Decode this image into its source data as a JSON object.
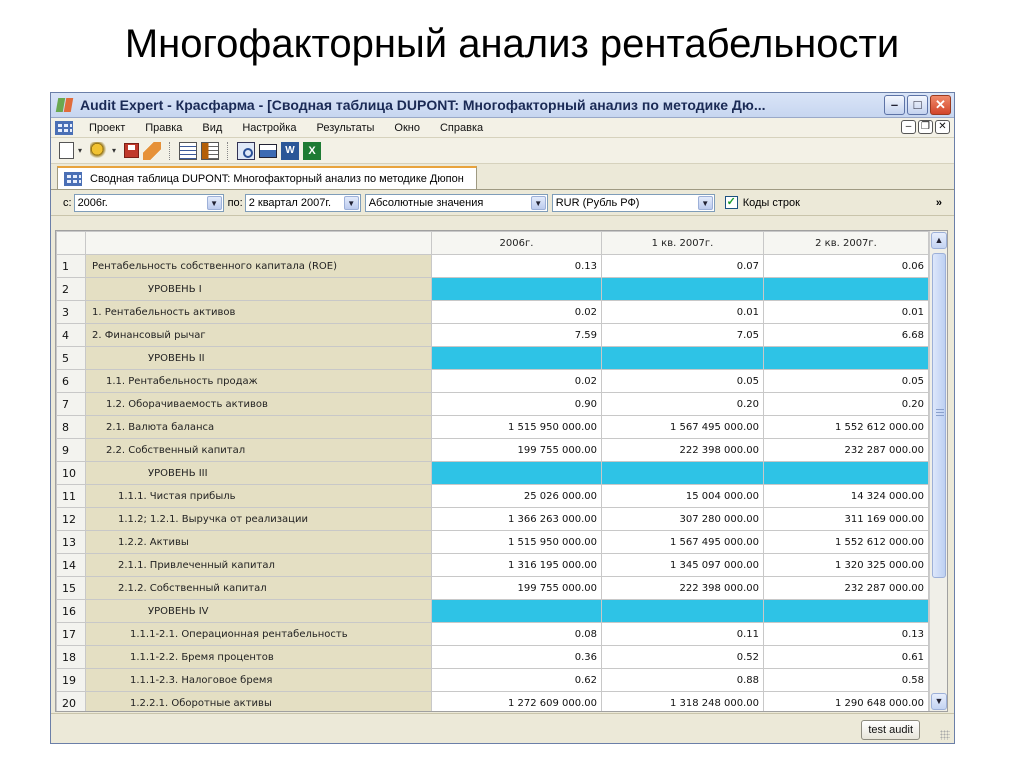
{
  "slide": {
    "title": "Многофакторный анализ рентабельности"
  },
  "window": {
    "title": "Audit Expert - Красфарма  - [Сводная таблица DUPONT: Многофакторный анализ по методике Дю...",
    "minimize": "–",
    "maximize": "□",
    "close": "✕"
  },
  "menu": {
    "items": [
      "Проект",
      "Правка",
      "Вид",
      "Настройка",
      "Результаты",
      "Окно",
      "Справка"
    ],
    "mdi_minimize": "–",
    "mdi_restore": "❐",
    "mdi_close": "✕"
  },
  "toolbar": {
    "icons": [
      "new-document-icon",
      "tools-icon",
      "save-icon",
      "erase-icon",
      "table-view-icon",
      "report-view-icon",
      "print-preview-icon",
      "print-icon",
      "word-export-icon",
      "excel-export-icon"
    ]
  },
  "tab": {
    "label": "Сводная таблица DUPONT: Многофакторный анализ по методике Дюпон"
  },
  "filters": {
    "from_label": "с:",
    "from_value": "2006г.",
    "to_label": "по:",
    "to_value": "2 квартал 2007г.",
    "mode_value": "Абсолютные значения",
    "currency_value": "RUR (Рубль РФ)",
    "codes_checked": "✓",
    "codes_label": "Коды строк",
    "more": "»"
  },
  "grid": {
    "columns": [
      "2006г.",
      "1 кв. 2007г.",
      "2 кв. 2007г."
    ],
    "rows": [
      {
        "n": "1",
        "label": "Рентабельность собственного капитала (ROE)",
        "level": false,
        "indent": 0,
        "v": [
          "0.13",
          "0.07",
          "0.06"
        ]
      },
      {
        "n": "2",
        "label": "УРОВЕНЬ I",
        "level": true,
        "indent": 0,
        "v": [
          "",
          "",
          ""
        ]
      },
      {
        "n": "3",
        "label": "1. Рентабельность активов",
        "level": false,
        "indent": 0,
        "v": [
          "0.02",
          "0.01",
          "0.01"
        ]
      },
      {
        "n": "4",
        "label": "2. Финансовый рычаг",
        "level": false,
        "indent": 0,
        "v": [
          "7.59",
          "7.05",
          "6.68"
        ]
      },
      {
        "n": "5",
        "label": "УРОВЕНЬ II",
        "level": true,
        "indent": 0,
        "v": [
          "",
          "",
          ""
        ]
      },
      {
        "n": "6",
        "label": "1.1. Рентабельность продаж",
        "level": false,
        "indent": 1,
        "v": [
          "0.02",
          "0.05",
          "0.05"
        ]
      },
      {
        "n": "7",
        "label": "1.2. Оборачиваемость активов",
        "level": false,
        "indent": 1,
        "v": [
          "0.90",
          "0.20",
          "0.20"
        ]
      },
      {
        "n": "8",
        "label": "2.1. Валюта баланса",
        "level": false,
        "indent": 1,
        "v": [
          "1 515 950 000.00",
          "1 567 495 000.00",
          "1 552 612 000.00"
        ]
      },
      {
        "n": "9",
        "label": "2.2. Собственный капитал",
        "level": false,
        "indent": 1,
        "v": [
          "199 755 000.00",
          "222 398 000.00",
          "232 287 000.00"
        ]
      },
      {
        "n": "10",
        "label": "УРОВЕНЬ III",
        "level": true,
        "indent": 0,
        "v": [
          "",
          "",
          ""
        ]
      },
      {
        "n": "11",
        "label": "1.1.1. Чистая прибыль",
        "level": false,
        "indent": 2,
        "v": [
          "25 026 000.00",
          "15 004 000.00",
          "14 324 000.00"
        ]
      },
      {
        "n": "12",
        "label": "1.1.2; 1.2.1. Выручка от реализации",
        "level": false,
        "indent": 2,
        "v": [
          "1 366 263 000.00",
          "307 280 000.00",
          "311 169 000.00"
        ]
      },
      {
        "n": "13",
        "label": "1.2.2. Активы",
        "level": false,
        "indent": 2,
        "v": [
          "1 515 950 000.00",
          "1 567 495 000.00",
          "1 552 612 000.00"
        ]
      },
      {
        "n": "14",
        "label": "2.1.1. Привлеченный капитал",
        "level": false,
        "indent": 2,
        "v": [
          "1 316 195 000.00",
          "1 345 097 000.00",
          "1 320 325 000.00"
        ]
      },
      {
        "n": "15",
        "label": "2.1.2. Собственный капитал",
        "level": false,
        "indent": 2,
        "v": [
          "199 755 000.00",
          "222 398 000.00",
          "232 287 000.00"
        ]
      },
      {
        "n": "16",
        "label": "УРОВЕНЬ IV",
        "level": true,
        "indent": 0,
        "v": [
          "",
          "",
          ""
        ]
      },
      {
        "n": "17",
        "label": "1.1.1-2.1. Операционная рентабельность",
        "level": false,
        "indent": 3,
        "v": [
          "0.08",
          "0.11",
          "0.13"
        ]
      },
      {
        "n": "18",
        "label": "1.1.1-2.2. Бремя процентов",
        "level": false,
        "indent": 3,
        "v": [
          "0.36",
          "0.52",
          "0.61"
        ]
      },
      {
        "n": "19",
        "label": "1.1.1-2.3. Налоговое бремя",
        "level": false,
        "indent": 3,
        "v": [
          "0.62",
          "0.88",
          "0.58"
        ]
      },
      {
        "n": "20",
        "label": "1.2.2.1. Оборотные активы",
        "level": false,
        "indent": 3,
        "v": [
          "1 272 609 000.00",
          "1 318 248 000.00",
          "1 290 648 000.00"
        ]
      }
    ]
  },
  "scroll": {
    "up": "▲",
    "down": "▼"
  },
  "status": {
    "test_button": "test audit"
  },
  "colors": {
    "level_fill": "#2ec3e6",
    "label_fill": "#e4dfc3"
  }
}
